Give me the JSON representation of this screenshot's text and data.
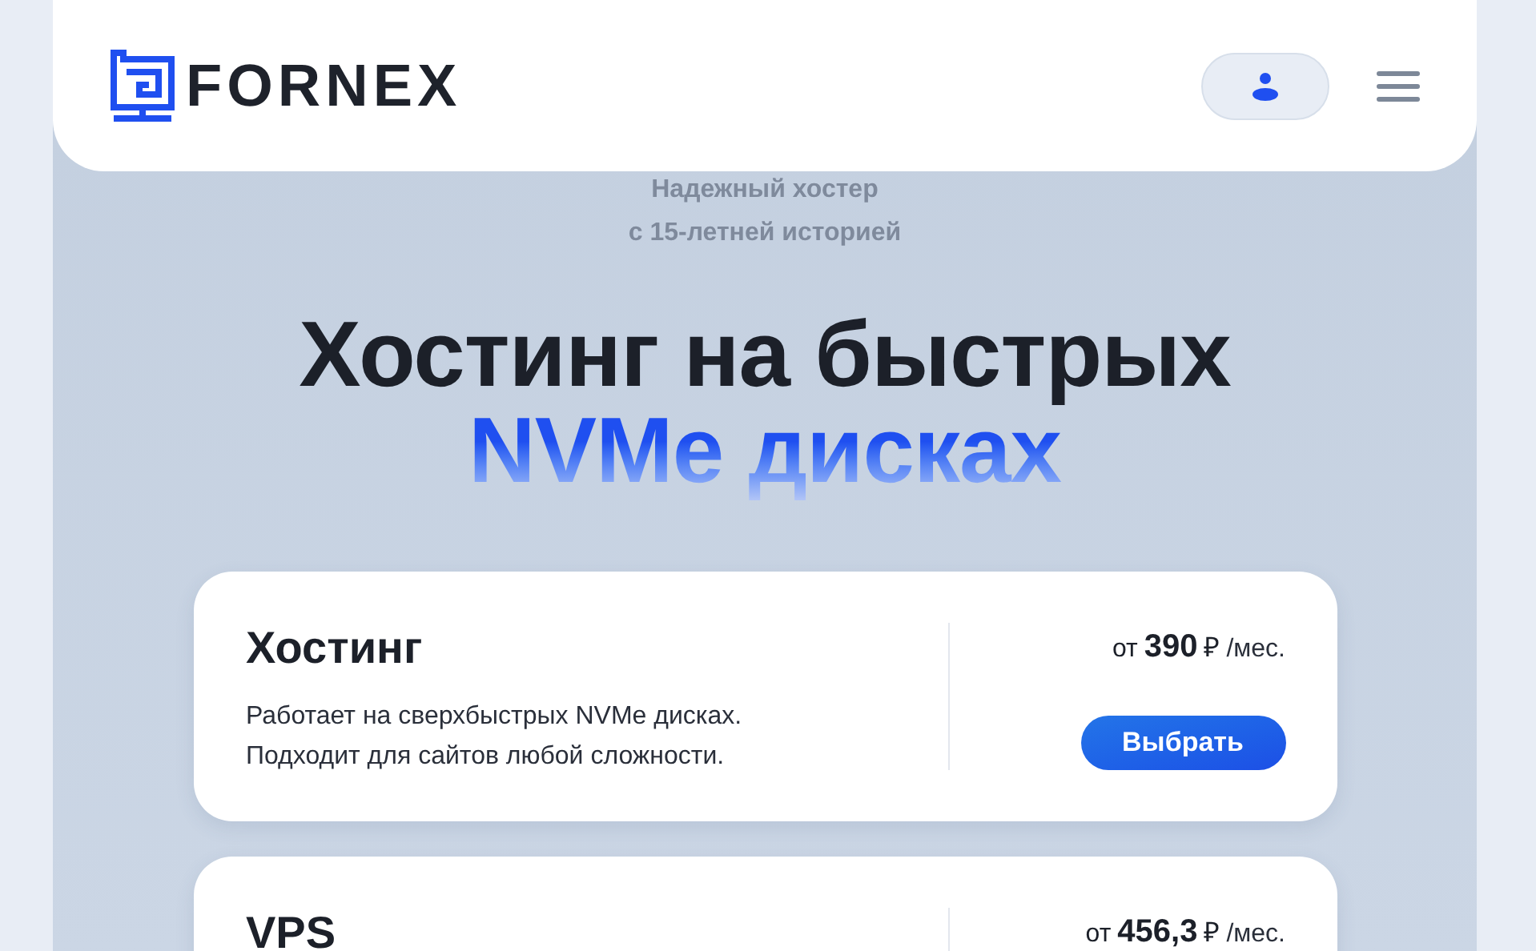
{
  "header": {
    "logo_text": "FORNEX"
  },
  "hero": {
    "tagline": [
      "Надежный хостер",
      "с 15-летней историей"
    ],
    "title": "Хостинг на быстрых",
    "title_accent": "NVMe дисках"
  },
  "cards": [
    {
      "title": "Хостинг",
      "description": [
        "Работает на сверхбыстрых NVMe дисках.",
        "Подходит для сайтов любой сложности."
      ],
      "price_prefix": "от",
      "price": "390",
      "currency": "₽",
      "period": "/мес.",
      "button": "Выбрать"
    },
    {
      "title": "VPS",
      "price_prefix": "от",
      "price": "456,3",
      "currency": "₽",
      "period": "/мес."
    }
  ]
}
